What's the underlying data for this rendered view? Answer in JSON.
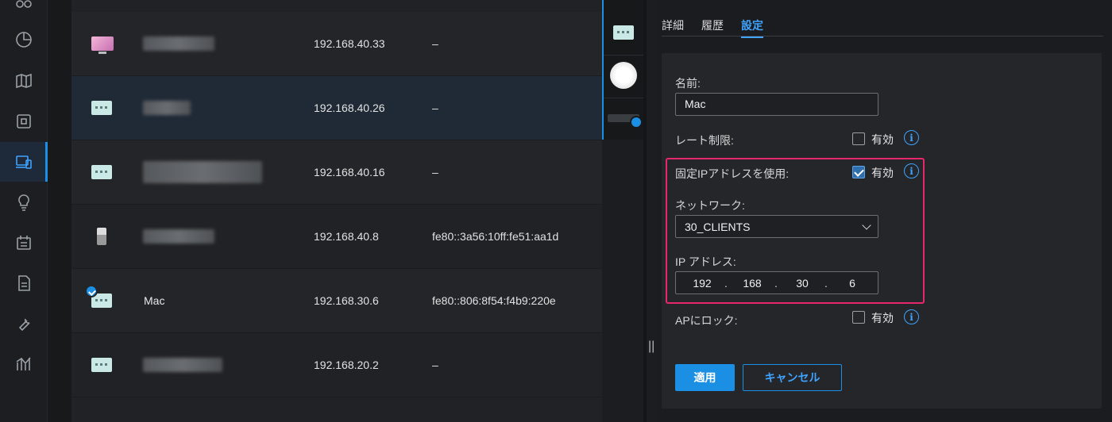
{
  "nav": {
    "items": [
      {
        "icon": "topology-icon"
      },
      {
        "icon": "dashboard-pie-icon"
      },
      {
        "icon": "map-icon"
      },
      {
        "icon": "devices-icon"
      },
      {
        "icon": "clients-icon",
        "active": true
      },
      {
        "icon": "insights-bulb-icon"
      },
      {
        "icon": "calendar-icon"
      },
      {
        "icon": "document-icon"
      },
      {
        "icon": "wrench-icon"
      },
      {
        "icon": "statistics-icon"
      }
    ]
  },
  "clients": [
    {
      "icon": "tv-icon",
      "name": "",
      "ip": "192.168.40.33",
      "ipv6": "–"
    },
    {
      "icon": "ethernet-device-icon",
      "name": "",
      "ip": "192.168.40.26",
      "ipv6": "–"
    },
    {
      "icon": "ethernet-device-icon",
      "name": "",
      "ip": "192.168.40.16",
      "ipv6": "–"
    },
    {
      "icon": "usb-device-icon",
      "name": "",
      "ip": "192.168.40.8",
      "ipv6": "fe80::3a56:10ff:fe51:aa1d"
    },
    {
      "icon": "ethernet-device-icon",
      "name": "Mac",
      "ip": "192.168.30.6",
      "ipv6": "fe80::806:8f54:f4b9:220e"
    },
    {
      "icon": "ethernet-device-icon",
      "name": "",
      "ip": "192.168.20.2",
      "ipv6": "–"
    }
  ],
  "panel": {
    "tabs": [
      "詳細",
      "履歴",
      "設定"
    ],
    "active_tab": "設定",
    "name_label": "名前:",
    "name_value": "Mac",
    "rate_limit_label": "レート制限:",
    "rate_limit_check": "有効",
    "fixed_ip_label": "固定IPアドレスを使用:",
    "fixed_ip_check": "有効",
    "network_label": "ネットワーク:",
    "network_value": "30_CLIENTS",
    "ip_label": "IP アドレス:",
    "ip_octets": [
      "192",
      "168",
      "30",
      "6"
    ],
    "ap_lock_label": "APにロック:",
    "ap_lock_check": "有効",
    "apply_label": "適用",
    "cancel_label": "キャンセル",
    "info_glyph": "i"
  },
  "colors": {
    "accent": "#1a8fe3",
    "highlight_border": "#e8266a"
  }
}
